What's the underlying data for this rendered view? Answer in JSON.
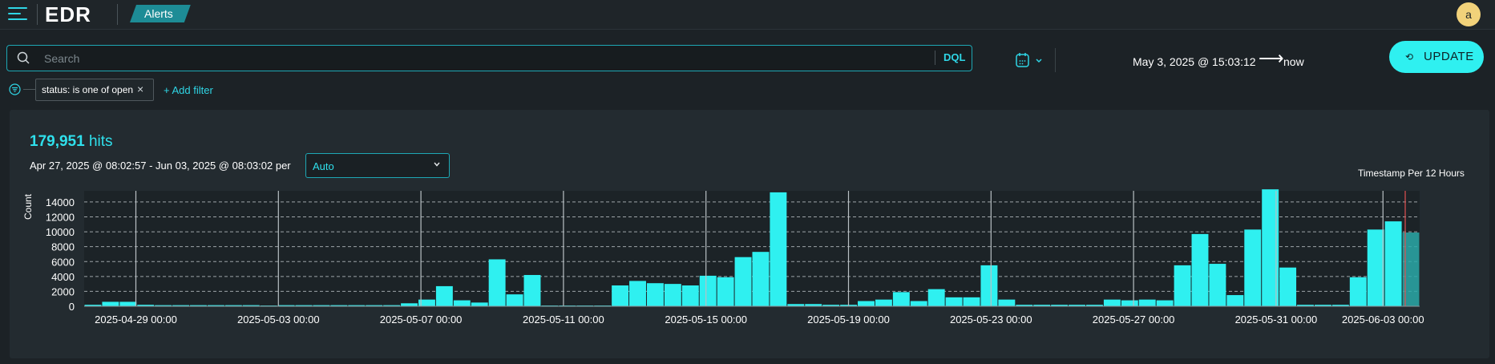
{
  "header": {
    "logo": "EDR",
    "breadcrumb": "Alerts",
    "avatar_initial": "a"
  },
  "query": {
    "search_placeholder": "Search",
    "language_label": "DQL",
    "date_start": "May 3, 2025 @ 15:03:12",
    "date_arrow": "⟶",
    "date_end": "now",
    "update_label": "UPDATE"
  },
  "filters": {
    "active_filter": "status: is one of open",
    "add_filter_label": "+ Add filter"
  },
  "summary": {
    "hits_count": "179,951",
    "hits_suffix": "hits",
    "range_text": "Apr 27, 2025 @ 08:02:57 - Jun 03, 2025 @ 08:03:02 per",
    "interval_value": "Auto"
  },
  "colors": {
    "accent": "#2fd6e6",
    "bar": "#2ff0f0",
    "update_button": "#2ff0f0",
    "avatar": "#f2d27a",
    "now_marker": "#e05050"
  },
  "chart_data": {
    "type": "bar",
    "title": "Timestamp Per 12 Hours",
    "xlabel": "",
    "ylabel": "Count",
    "ylim": [
      0,
      15500
    ],
    "yticks": [
      0,
      2000,
      4000,
      6000,
      8000,
      10000,
      12000,
      14000
    ],
    "ytick_labels": [
      "0",
      "2000",
      "4000",
      "6000",
      "8000",
      "10000",
      "12000",
      "14000"
    ],
    "x_tick_labels": [
      "2025-04-29 00:00",
      "2025-05-03 00:00",
      "2025-05-07 00:00",
      "2025-05-11 00:00",
      "2025-05-15 00:00",
      "2025-05-19 00:00",
      "2025-05-23 00:00",
      "2025-05-27 00:00",
      "2025-05-31 00:00",
      "2025-06-03 00:00"
    ],
    "interval": "12 hours",
    "grid": true,
    "values": [
      200,
      600,
      600,
      200,
      150,
      150,
      150,
      150,
      150,
      150,
      100,
      150,
      150,
      150,
      150,
      150,
      150,
      150,
      400,
      900,
      2700,
      800,
      500,
      6300,
      1600,
      4200,
      100,
      100,
      100,
      100,
      2800,
      3400,
      3100,
      3000,
      2800,
      4100,
      3900,
      6600,
      7300,
      15300,
      300,
      300,
      200,
      200,
      700,
      900,
      1900,
      700,
      2300,
      1200,
      1200,
      5500,
      900,
      200,
      200,
      200,
      200,
      200,
      900,
      800,
      900,
      800,
      5500,
      9700,
      5700,
      1500,
      10300,
      15700,
      5200,
      200,
      200,
      200,
      3900,
      10300,
      11400,
      9900
    ],
    "partial_last_bucket": true
  }
}
